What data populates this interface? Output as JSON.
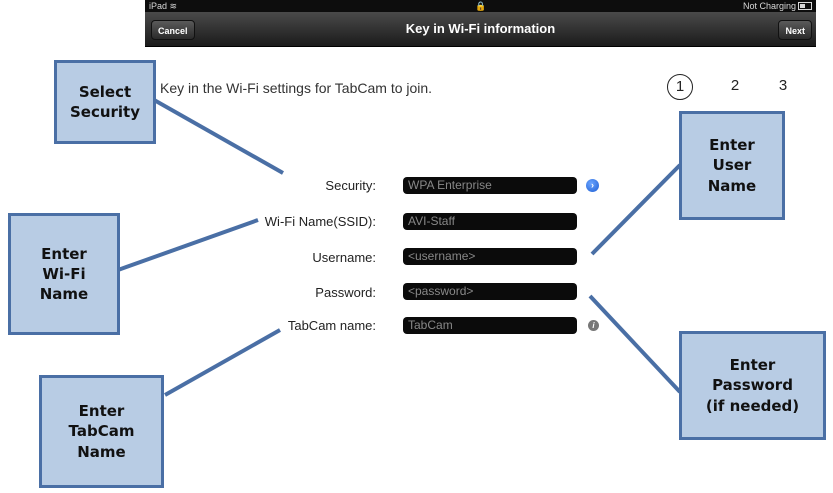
{
  "status_bar": {
    "device": "iPad",
    "lock": "🔒",
    "battery_text": "Not Charging"
  },
  "nav": {
    "cancel_label": "Cancel",
    "title": "Key in Wi-Fi information",
    "next_label": "Next"
  },
  "instruction": "Key in the Wi-Fi settings for TabCam to join.",
  "steps": [
    "1",
    "2",
    "3"
  ],
  "form": {
    "security_label": "Security:",
    "security_value": "WPA Enterprise",
    "ssid_label": "Wi-Fi Name(SSID):",
    "ssid_value": "AVI-Staff",
    "username_label": "Username:",
    "username_placeholder": "<username>",
    "password_label": "Password:",
    "password_placeholder": "<password>",
    "tabcam_label": "TabCam name:",
    "tabcam_value": "TabCam"
  },
  "callouts": {
    "select_security": "Select\nSecurity",
    "enter_wifi": "Enter\nWi-Fi\nName",
    "enter_tabcam": "Enter\nTabCam\nName",
    "enter_user": "Enter\nUser\nName",
    "enter_password": "Enter\nPassword\n(if needed)"
  },
  "colors": {
    "callout_fill": "#b8cce4",
    "callout_border": "#4a6fa5",
    "disclosure": "#1f5fd3"
  },
  "icons": {
    "wifi": "wifi-icon",
    "lock": "lock-icon",
    "battery": "battery-icon",
    "disclosure": "chevron-right-icon",
    "info": "info-icon"
  }
}
